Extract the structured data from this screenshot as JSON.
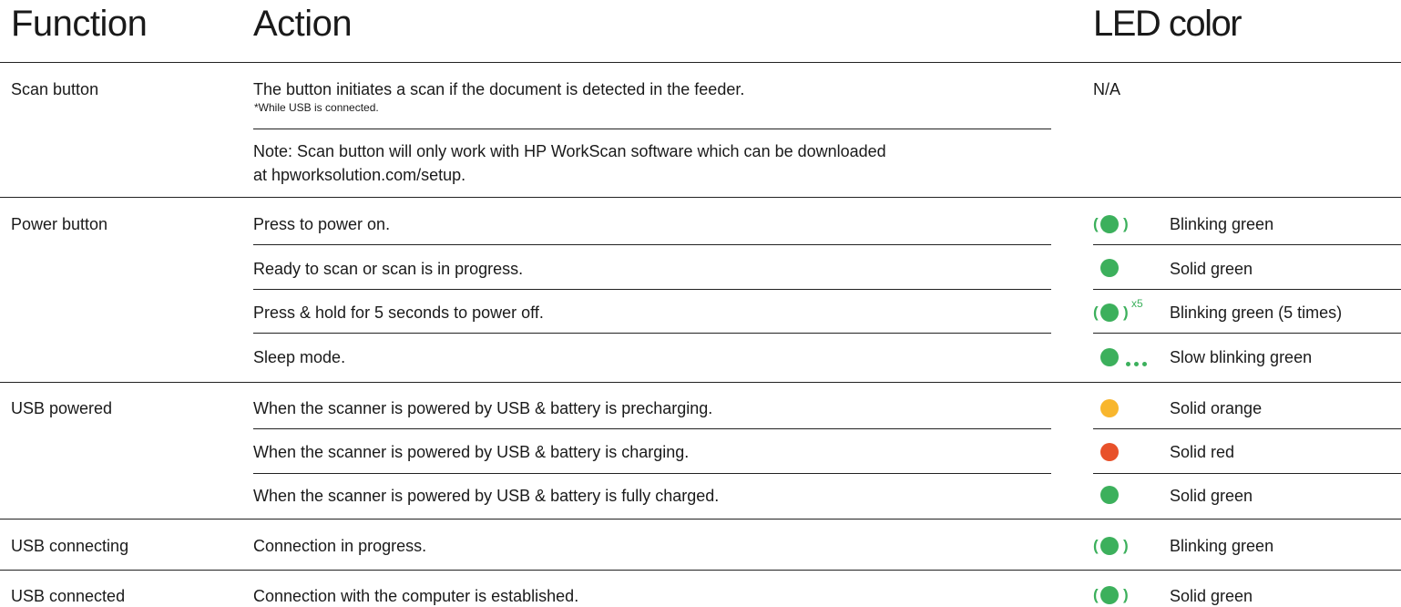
{
  "colors": {
    "green": "#3cb05c",
    "orange": "#f8b62d",
    "red": "#e8512a",
    "text": "#1a1a1a",
    "rule": "#222222"
  },
  "headers": {
    "function": "Function",
    "action": "Action",
    "led": "LED color"
  },
  "scan": {
    "function": "Scan button",
    "action": "The button initiates a scan if the document is detected in the feeder.",
    "footnote": "*While USB is connected.",
    "note_line1": "Note: Scan button will only work with HP WorkScan software which can be downloaded",
    "note_line2": "at hpworksolution.com/setup.",
    "led": "N/A"
  },
  "power": {
    "function": "Power button",
    "rows": [
      {
        "action": "Press to power on.",
        "led": "Blinking green",
        "icon": "blinking-green-icon"
      },
      {
        "action": "Ready to scan or scan is in progress.",
        "led": "Solid green",
        "icon": "solid-green-icon"
      },
      {
        "action": "Press & hold for 5 seconds to power off.",
        "led": "Blinking green (5 times)",
        "icon": "blinking-green-x5-icon",
        "icon_suffix": "x5"
      },
      {
        "action": "Sleep mode.",
        "led": "Slow blinking green",
        "icon": "slow-blinking-green-icon"
      }
    ]
  },
  "usb_powered": {
    "function": "USB powered",
    "rows": [
      {
        "action": "When the scanner is powered by USB & battery is precharging.",
        "led": "Solid orange",
        "icon": "solid-orange-icon"
      },
      {
        "action": "When the scanner is powered by USB & battery is charging.",
        "led": "Solid red",
        "icon": "solid-red-icon"
      },
      {
        "action": "When the scanner is powered by USB & battery is fully charged.",
        "led": "Solid green",
        "icon": "solid-green-icon"
      }
    ]
  },
  "usb_connecting": {
    "function": "USB connecting",
    "action": "Connection in progress.",
    "led": "Blinking green",
    "icon": "blinking-green-icon"
  },
  "usb_connected": {
    "function": "USB connected",
    "action": "Connection with the computer is established.",
    "led": "Solid green",
    "icon": "blinking-green-icon"
  }
}
